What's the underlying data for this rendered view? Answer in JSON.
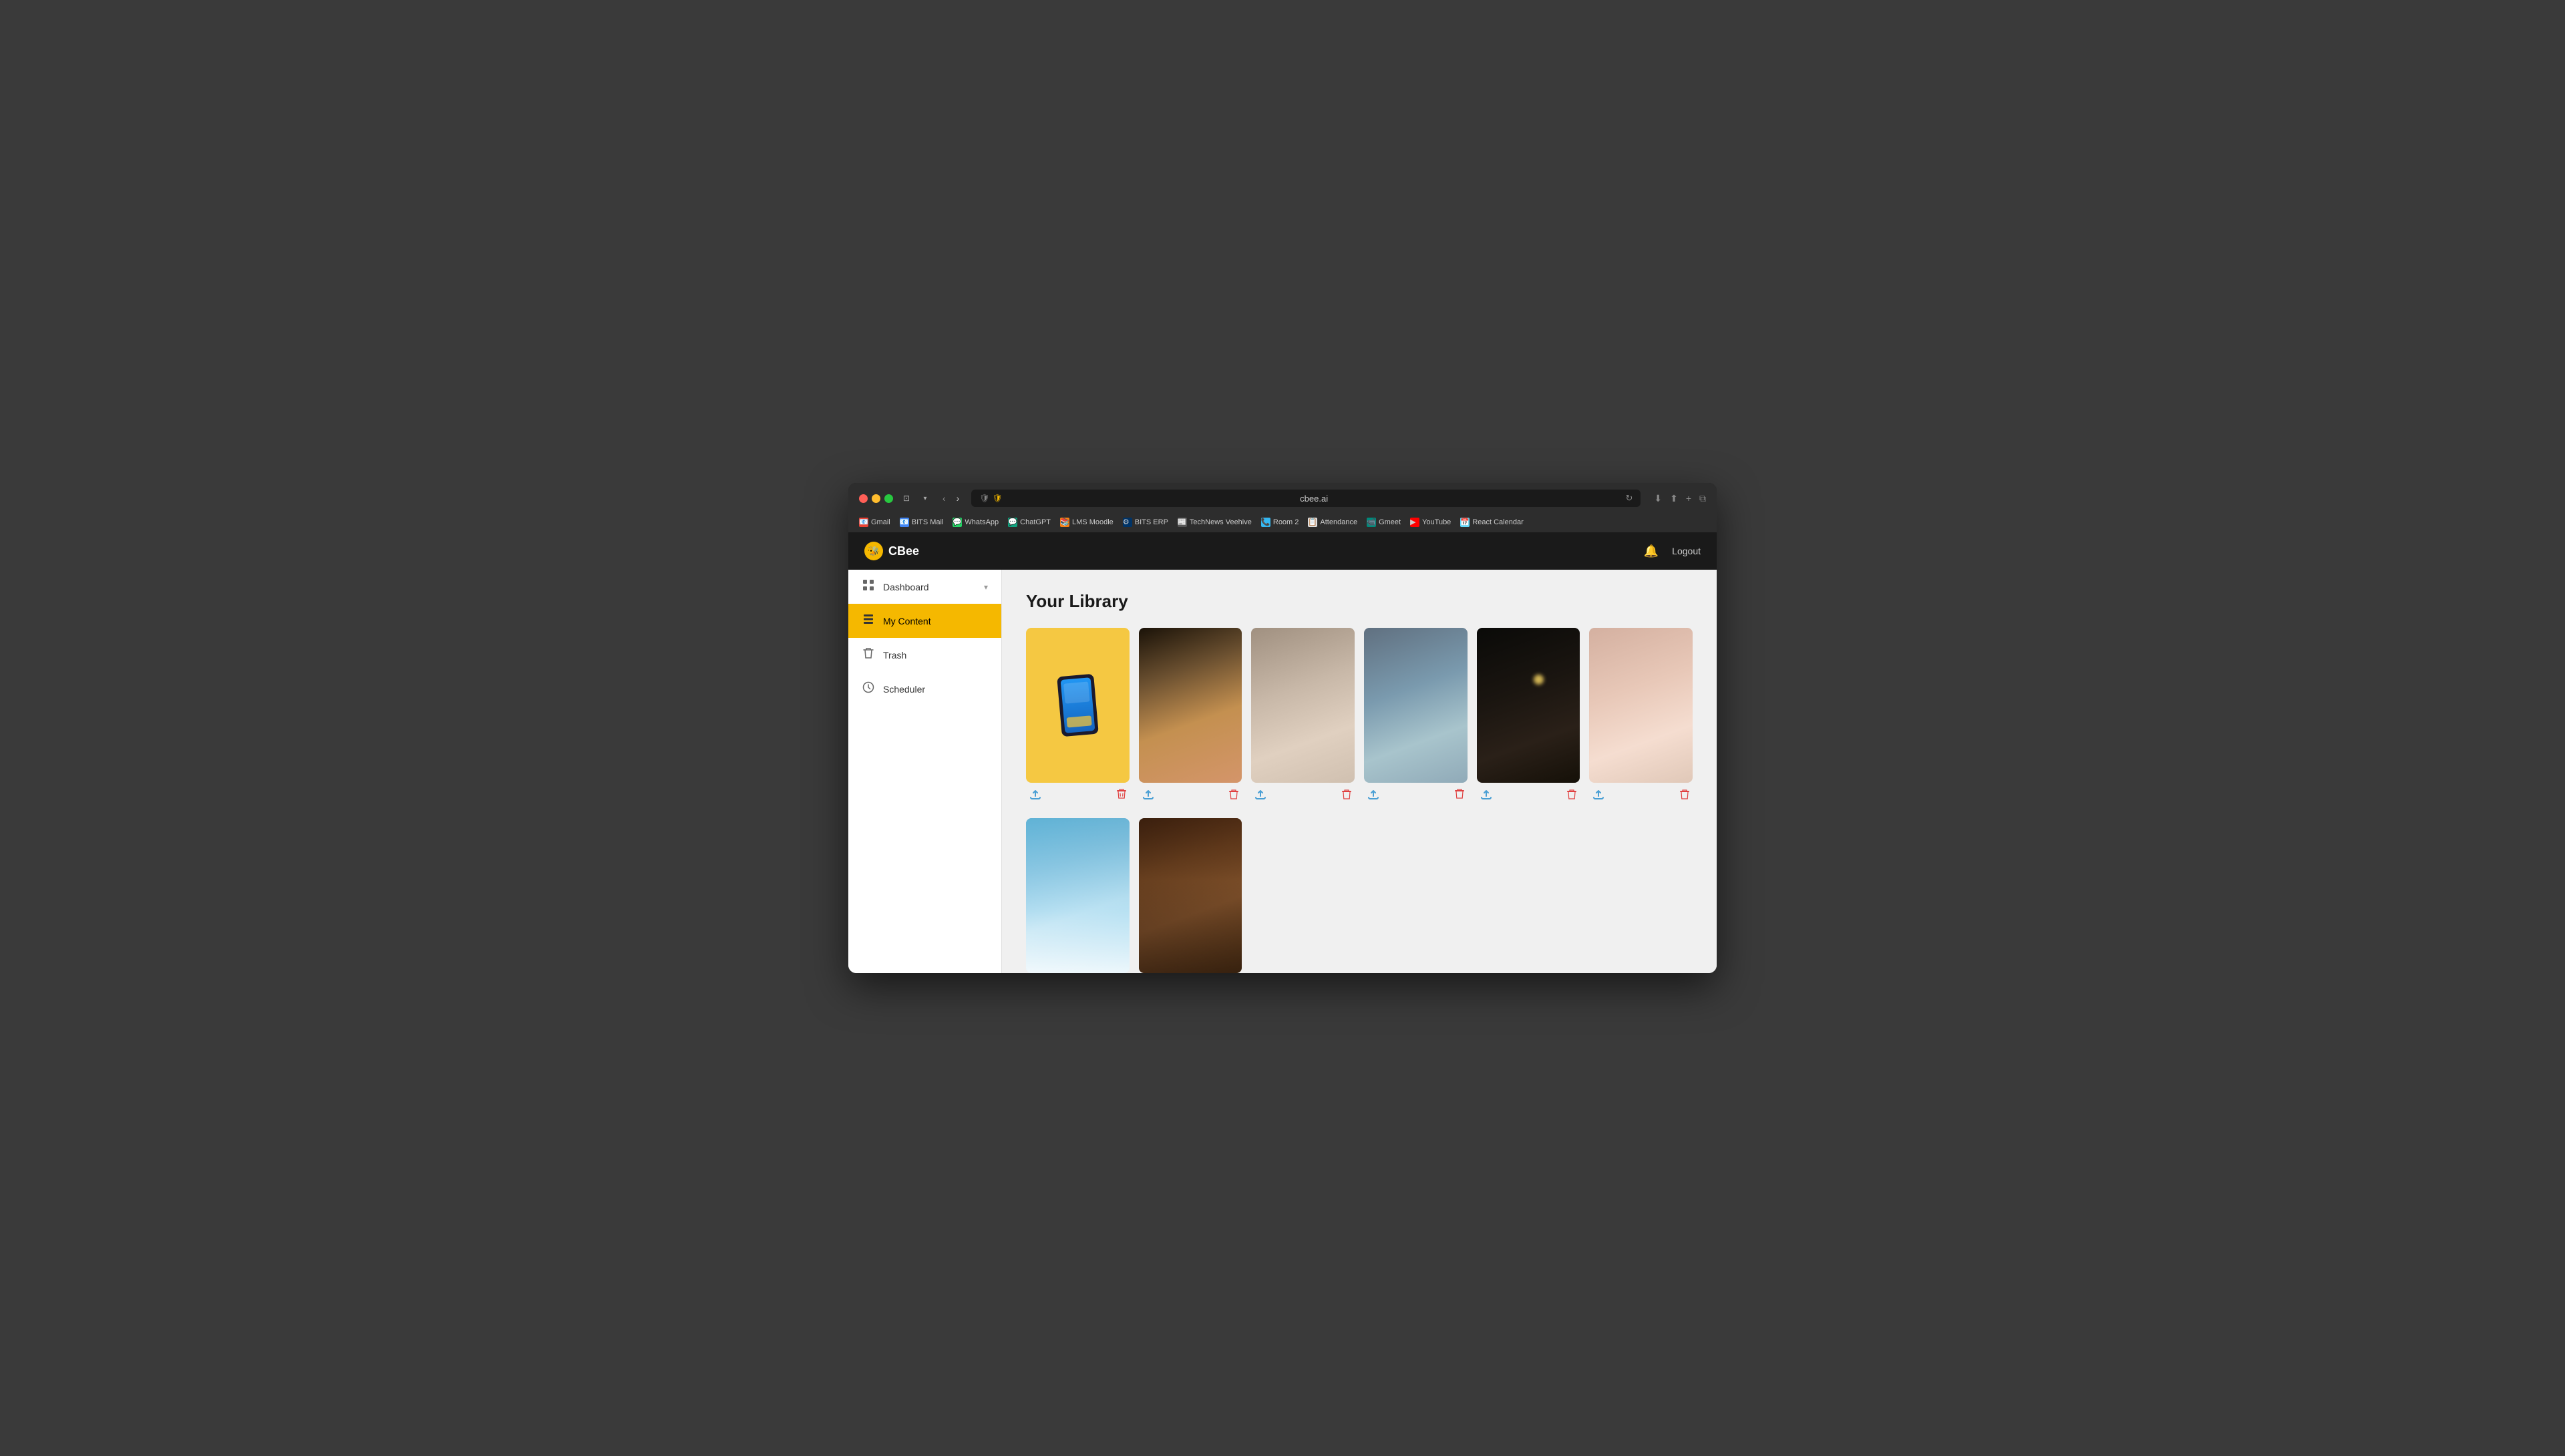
{
  "browser": {
    "url": "cbee.ai",
    "bookmarks": [
      {
        "label": "Gmail",
        "icon": "📧"
      },
      {
        "label": "BITS Mail",
        "icon": "📧"
      },
      {
        "label": "WhatsApp",
        "icon": "💬"
      },
      {
        "label": "ChatGPT",
        "icon": "💬"
      },
      {
        "label": "LMS Moodle",
        "icon": "📚"
      },
      {
        "label": "BITS ERP",
        "icon": "⚙"
      },
      {
        "label": "TechNews Veehive",
        "icon": "📰"
      },
      {
        "label": "Room 2",
        "icon": "📞"
      },
      {
        "label": "Attendance",
        "icon": "📋"
      },
      {
        "label": "Gmeet",
        "icon": "📹"
      },
      {
        "label": "YouTube",
        "icon": "▶"
      },
      {
        "label": "React Calendar",
        "icon": "📅"
      }
    ]
  },
  "app": {
    "logo": "CBee",
    "logo_icon": "🐝",
    "bell_label": "🔔",
    "logout_label": "Logout"
  },
  "sidebar": {
    "items": [
      {
        "id": "dashboard",
        "label": "Dashboard",
        "icon": "⊞",
        "has_chevron": true
      },
      {
        "id": "my-content",
        "label": "My Content",
        "icon": "📋",
        "active": true
      },
      {
        "id": "trash",
        "label": "Trash",
        "icon": "🗑"
      },
      {
        "id": "scheduler",
        "label": "Scheduler",
        "icon": "🕐"
      }
    ]
  },
  "main": {
    "title": "Your Library",
    "images": [
      {
        "id": 1,
        "color": "#f5c842",
        "type": "illustration"
      },
      {
        "id": 2,
        "color": "#8a7560",
        "type": "photo"
      },
      {
        "id": 3,
        "color": "#c8bfb5",
        "type": "photo"
      },
      {
        "id": 4,
        "color": "#7a9aae",
        "type": "photo"
      },
      {
        "id": 5,
        "color": "#1a1a1a",
        "type": "photo"
      },
      {
        "id": 6,
        "color": "#d4a896",
        "type": "photo"
      },
      {
        "id": 7,
        "color": "#a8d0e8",
        "type": "photo"
      },
      {
        "id": 8,
        "color": "#8a6040",
        "type": "photo"
      }
    ]
  }
}
